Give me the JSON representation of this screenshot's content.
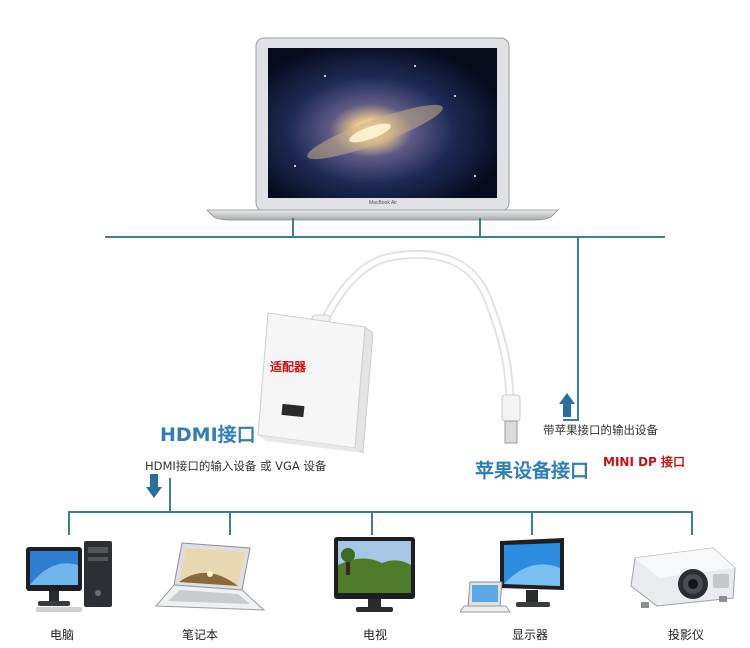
{
  "laptop": {
    "brand_label": "MacBook Air"
  },
  "adapter": {
    "label": "适配器"
  },
  "hdmi": {
    "title": "HDMI接口",
    "desc": "HDMI接口的输入设备 或 VGA 设备"
  },
  "apple": {
    "desc": "带苹果接口的输出设备",
    "title": "苹果设备接口",
    "mini_dp": "MINI DP 接口"
  },
  "devices": [
    {
      "label": "电脑",
      "icon": "desktop-computer-icon"
    },
    {
      "label": "笔记本",
      "icon": "laptop-icon"
    },
    {
      "label": "电视",
      "icon": "tv-icon"
    },
    {
      "label": "显示器",
      "icon": "monitor-icon"
    },
    {
      "label": "投影仪",
      "icon": "projector-icon"
    }
  ],
  "colors": {
    "line": "#3f7f95",
    "arrow": "#2a6ea0",
    "title": "#2f7fb5",
    "accent_red": "#cc1111"
  }
}
